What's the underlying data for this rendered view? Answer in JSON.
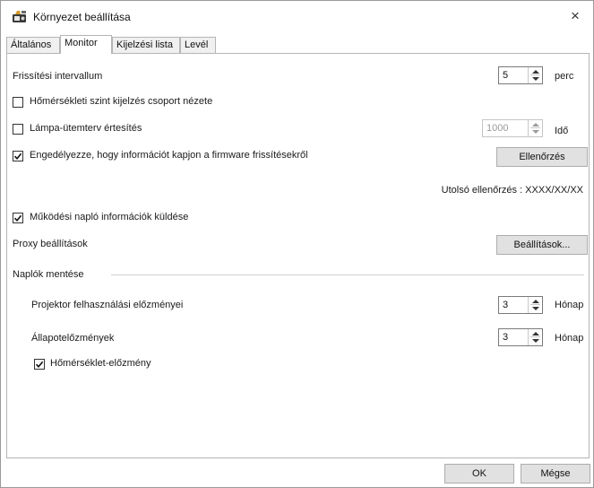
{
  "window": {
    "title": "Környezet beállítása",
    "close_glyph": "×",
    "app_icon": "projector-settings-icon"
  },
  "tabs": [
    {
      "label": "Általános"
    },
    {
      "label": "Monitor"
    },
    {
      "label": "Kijelzési lista"
    },
    {
      "label": "Levél"
    }
  ],
  "monitor": {
    "refresh_interval": {
      "label": "Frissítési intervallum",
      "value": "5",
      "unit": "perc"
    },
    "temp_group_view": {
      "label": "Hőmérsékleti szint kijelzés csoport nézete",
      "checked": false
    },
    "lamp_schedule": {
      "label": "Lámpa-ütemterv értesítés",
      "checked": false,
      "value": "1000",
      "unit": "Idő",
      "disabled": true
    },
    "firmware_updates": {
      "label": "Engedélyezze, hogy információt kapjon a firmware frissítésekről",
      "checked": true,
      "button": "Ellenőrzés"
    },
    "last_check": {
      "label": "Utolsó ellenőrzés : XXXX/XX/XX"
    },
    "send_log": {
      "label": "Működési napló információk küldése",
      "checked": true
    },
    "proxy": {
      "label": "Proxy beállítások",
      "button": "Beállítások..."
    },
    "log_save": {
      "group_label": "Naplók mentése",
      "usage_history": {
        "label": "Projektor felhasználási előzményei",
        "value": "3",
        "unit": "Hónap"
      },
      "status_history": {
        "label": "Állapotelőzmények",
        "value": "3",
        "unit": "Hónap"
      },
      "temp_history": {
        "label": "Hőmérséklet-előzmény",
        "checked": true
      }
    }
  },
  "footer": {
    "ok": "OK",
    "cancel": "Mégse"
  }
}
